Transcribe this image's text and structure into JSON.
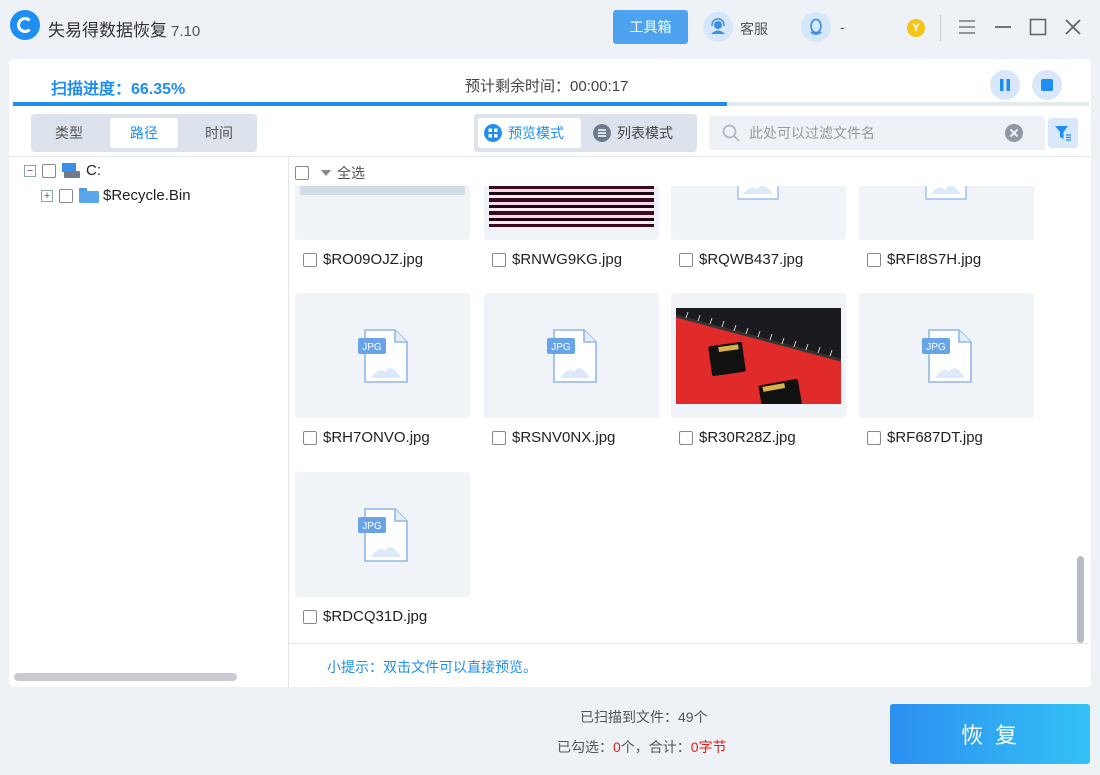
{
  "app": {
    "title": "失易得数据恢复",
    "version": "7.10"
  },
  "toolbar": {
    "toolbox_label": "工具箱",
    "service_label": "客服",
    "qq_label": "-",
    "badge": "Y"
  },
  "scan": {
    "progress_label": "扫描进度：66.35%",
    "progress": 0.6635,
    "eta_label": "预计剩余时间：",
    "eta_value": "00:00:17"
  },
  "view_tabs": [
    {
      "label": "类型",
      "active": false
    },
    {
      "label": "路径",
      "active": true
    },
    {
      "label": "时间",
      "active": false
    }
  ],
  "modes": {
    "preview_label": "预览模式",
    "list_label": "列表模式",
    "active": "preview"
  },
  "search": {
    "placeholder": "此处可以过滤文件名"
  },
  "tree": [
    {
      "label": "C:",
      "type": "drive",
      "expanded": true
    },
    {
      "label": "$Recycle.Bin",
      "type": "folder",
      "expanded": false
    }
  ],
  "select_all_label": "全选",
  "files": [
    {
      "name": "$RO09OJZ.jpg",
      "thumb": "gray-partial"
    },
    {
      "name": "$RNWG9KG.jpg",
      "thumb": "glitch-partial"
    },
    {
      "name": "$RQWB437.jpg",
      "thumb": "placeholder-partial"
    },
    {
      "name": "$RFI8S7H.jpg",
      "thumb": "placeholder-partial"
    },
    {
      "name": "$RH7ONVO.jpg",
      "thumb": "jpg-icon"
    },
    {
      "name": "$RSNV0NX.jpg",
      "thumb": "jpg-icon"
    },
    {
      "name": "$R30R28Z.jpg",
      "thumb": "sd-card-photo"
    },
    {
      "name": "$RF687DT.jpg",
      "thumb": "jpg-icon"
    },
    {
      "name": "$RDCQ31D.jpg",
      "thumb": "jpg-icon"
    }
  ],
  "jpg_icon_text": "JPG",
  "tip": "小提示：双击文件可以直接预览。",
  "footer": {
    "scanned_label": "已扫描到文件：",
    "scanned_value": "49个",
    "checked_prefix": "已勾选：",
    "checked_count": "0",
    "checked_mid": "个，合计：",
    "checked_size": "0字节",
    "recover_label": "恢复"
  },
  "colors": {
    "accent": "#1e8ef2",
    "warn": "#e0201c",
    "badge": "#f5c518"
  }
}
